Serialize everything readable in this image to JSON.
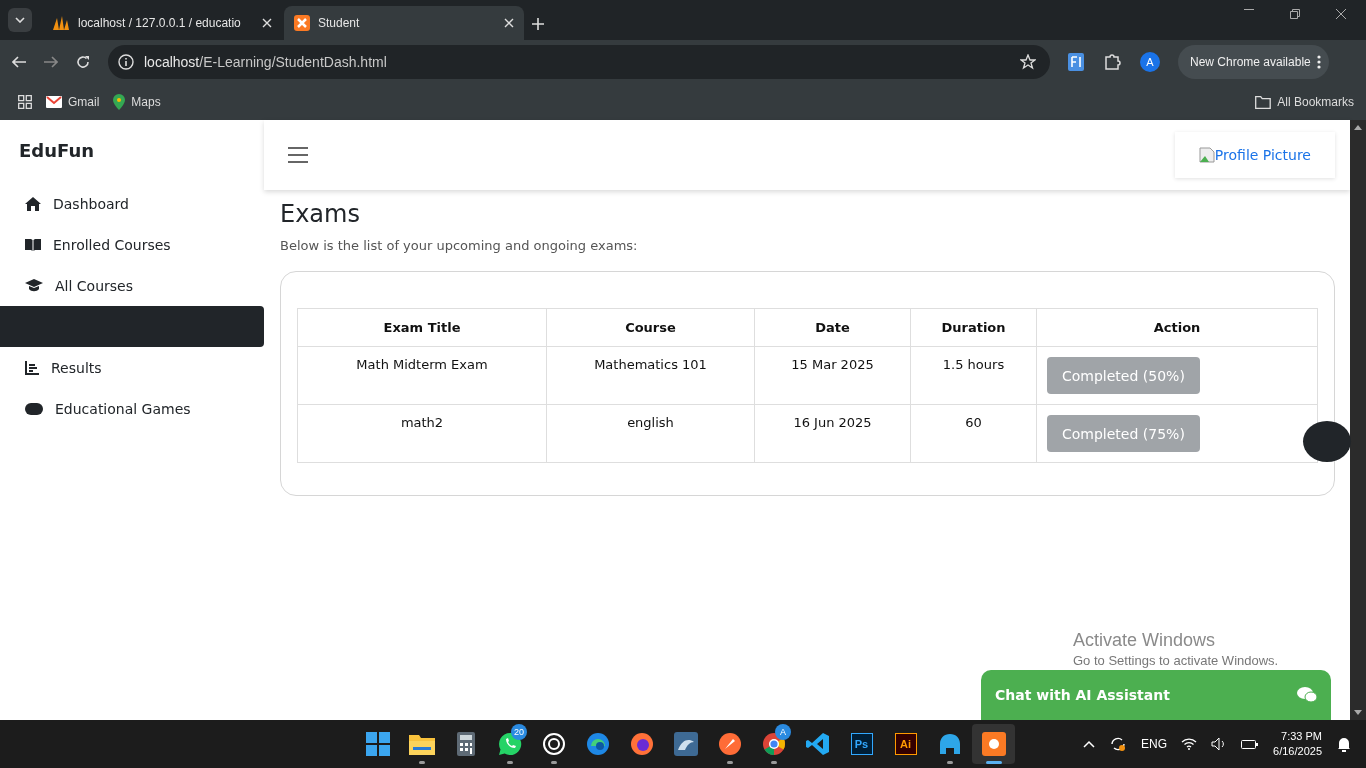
{
  "browser": {
    "tabs": [
      {
        "title": "localhost / 127.0.0.1 / educatio",
        "kind": "pma",
        "selected": false
      },
      {
        "title": "Student",
        "kind": "xampp",
        "selected": true
      }
    ],
    "url_host": "localhost",
    "url_path": "/E-Learning/StudentDash.html",
    "profile_initial": "A",
    "update_label": "New Chrome available",
    "bookmarks": [
      {
        "label": "Gmail",
        "kind": "gmail"
      },
      {
        "label": "Maps",
        "kind": "maps"
      }
    ],
    "all_bookmarks": "All Bookmarks"
  },
  "sidebar": {
    "brand": "EduFun",
    "items": [
      {
        "label": "Dashboard",
        "kind": "home",
        "selected": false
      },
      {
        "label": "Enrolled Courses",
        "kind": "book",
        "selected": false
      },
      {
        "label": "All Courses",
        "kind": "cap",
        "selected": false
      },
      {
        "kind": "blank",
        "selected": true
      },
      {
        "label": "Results",
        "kind": "chart",
        "selected": false
      },
      {
        "label": "Educational Games",
        "kind": "gamepad",
        "selected": false
      }
    ]
  },
  "header": {
    "profile_alt": "Profile Picture"
  },
  "page": {
    "title": "Exams",
    "subtitle": "Below is the list of your upcoming and ongoing exams:"
  },
  "table": {
    "columns": [
      "Exam Title",
      "Course",
      "Date",
      "Duration",
      "Action"
    ],
    "rows": [
      {
        "cells": [
          "Math Midterm Exam",
          "Mathematics 101",
          "15 Mar 2025",
          "1.5 hours"
        ],
        "action": "Completed (50%)",
        "disabled": true
      },
      {
        "cells": [
          "math2",
          "english",
          "16 Jun 2025",
          "60"
        ],
        "action": "Completed (75%)",
        "disabled": true
      }
    ]
  },
  "chat": {
    "label": "Chat with AI Assistant"
  },
  "activation": {
    "title": "Activate Windows",
    "hint": "Go to Settings to activate Windows."
  },
  "taskbar": {
    "apps": [
      {
        "kind": "start",
        "running": false,
        "selected": false
      },
      {
        "kind": "explorer",
        "running": true,
        "selected": false
      },
      {
        "kind": "calculator",
        "running": false,
        "selected": false
      },
      {
        "kind": "whatsapp",
        "running": true,
        "selected": false,
        "badge": "20"
      },
      {
        "kind": "chatgpt",
        "running": true,
        "selected": false
      },
      {
        "kind": "edge",
        "running": false,
        "selected": false
      },
      {
        "kind": "firefox",
        "running": false,
        "selected": false
      },
      {
        "kind": "workbench",
        "running": false,
        "selected": false
      },
      {
        "kind": "postman",
        "running": true,
        "selected": false
      },
      {
        "kind": "chrome",
        "running": true,
        "selected": false,
        "badge": "A"
      },
      {
        "kind": "vscode",
        "running": false,
        "selected": false
      },
      {
        "kind": "photoshop",
        "running": false,
        "selected": false,
        "glyph": "Ps"
      },
      {
        "kind": "illustrator",
        "running": false,
        "selected": false,
        "glyph": "Ai"
      },
      {
        "kind": "bird",
        "running": true,
        "selected": false
      },
      {
        "kind": "xampp",
        "running": true,
        "selected": true
      }
    ],
    "lang": "ENG",
    "time": "7:33 PM",
    "date": "6/16/2025"
  }
}
